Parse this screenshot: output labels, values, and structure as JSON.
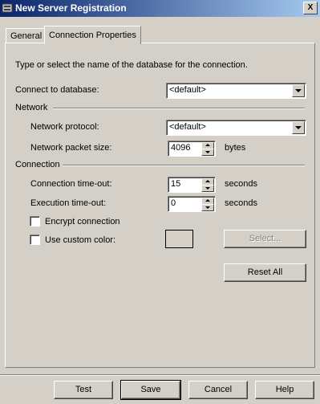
{
  "window": {
    "title": "New Server Registration",
    "close_glyph": "X"
  },
  "tabs": [
    {
      "label": "General"
    },
    {
      "label": "Connection Properties"
    }
  ],
  "intro_text": "Type or select the name of the database for the connection.",
  "connect_to_database": {
    "label": "Connect to database:",
    "value": "<default>"
  },
  "network_group": {
    "title": "Network",
    "protocol": {
      "label": "Network protocol:",
      "value": "<default>"
    },
    "packet_size": {
      "label": "Network packet size:",
      "value": "4096",
      "unit": "bytes"
    }
  },
  "connection_group": {
    "title": "Connection",
    "connection_timeout": {
      "label": "Connection time-out:",
      "value": "15",
      "unit": "seconds"
    },
    "execution_timeout": {
      "label": "Execution time-out:",
      "value": "0",
      "unit": "seconds"
    },
    "encrypt": {
      "label": "Encrypt connection",
      "checked": false
    },
    "custom_color": {
      "label": "Use custom color:",
      "checked": false,
      "select_label": "Select..."
    }
  },
  "reset_all_label": "Reset All",
  "footer": {
    "test_label": "Test",
    "save_label": "Save",
    "cancel_label": "Cancel",
    "help_label": "Help"
  }
}
